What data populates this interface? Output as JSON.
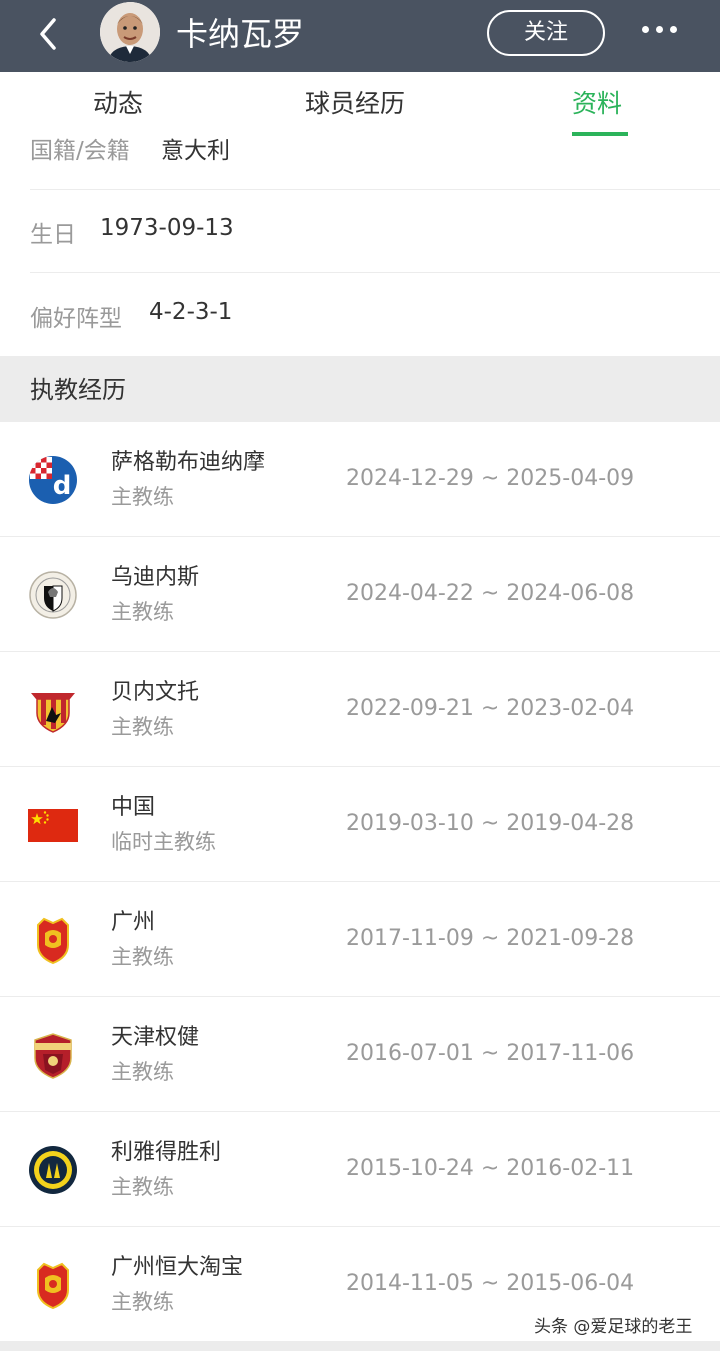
{
  "header": {
    "title": "卡纳瓦罗",
    "follow_label": "关注"
  },
  "tabs": [
    {
      "label": "动态",
      "active": false
    },
    {
      "label": "球员经历",
      "active": false
    },
    {
      "label": "资料",
      "active": true
    }
  ],
  "info": {
    "nationality_label": "国籍/会籍",
    "nationality_value": "意大利",
    "birthday_label": "生日",
    "birthday_value": "1973-09-13",
    "formation_label": "偏好阵型",
    "formation_value": "4-2-3-1"
  },
  "section_title": "执教经历",
  "coaching": [
    {
      "team": "萨格勒布迪纳摩",
      "role": "主教练",
      "period": "2024-12-29 ~ 2025-04-09",
      "logo": "dinamo-zagreb-logo"
    },
    {
      "team": "乌迪内斯",
      "role": "主教练",
      "period": "2024-04-22 ~ 2024-06-08",
      "logo": "udinese-logo"
    },
    {
      "team": "贝内文托",
      "role": "主教练",
      "period": "2022-09-21 ~ 2023-02-04",
      "logo": "benevento-logo"
    },
    {
      "team": "中国",
      "role": "临时主教练",
      "period": "2019-03-10 ~ 2019-04-28",
      "logo": "china-flag"
    },
    {
      "team": "广州",
      "role": "主教练",
      "period": "2017-11-09 ~ 2021-09-28",
      "logo": "guangzhou-logo"
    },
    {
      "team": "天津权健",
      "role": "主教练",
      "period": "2016-07-01 ~ 2017-11-06",
      "logo": "tianjin-quanjian-logo"
    },
    {
      "team": "利雅得胜利",
      "role": "主教练",
      "period": "2015-10-24 ~ 2016-02-11",
      "logo": "al-nassr-logo"
    },
    {
      "team": "广州恒大淘宝",
      "role": "主教练",
      "period": "2014-11-05 ~ 2015-06-04",
      "logo": "guangzhou-evergrande-logo"
    }
  ],
  "watermark": "头条 @爱足球的老王",
  "colors": {
    "header_bg": "#4a5361",
    "accent": "#2bb35a",
    "muted_text": "#9a9a9a",
    "section_bg": "#ececec"
  }
}
